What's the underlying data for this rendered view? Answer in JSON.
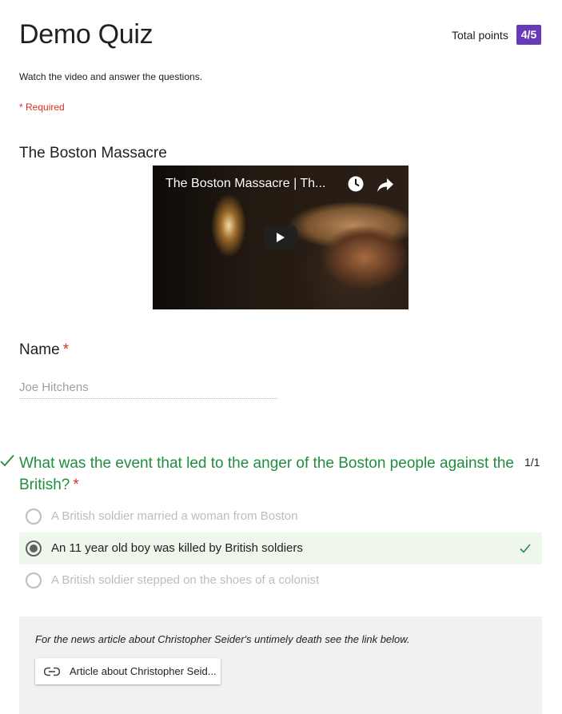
{
  "quiz": {
    "title": "Demo Quiz",
    "total_points_label": "Total points",
    "score": "4/5",
    "description": "Watch the video and answer the questions.",
    "required_note": "* Required"
  },
  "video_section": {
    "title": "The Boston Massacre",
    "video_title": "The Boston Massacre | Th...",
    "icons": [
      "clock-icon",
      "share-icon",
      "play-icon"
    ]
  },
  "name_question": {
    "label": "Name",
    "required_marker": "*",
    "value": "Joe Hitchens"
  },
  "mc_question": {
    "text": "What was the event that led to the anger of the Boston people against the British?",
    "required_marker": "*",
    "score": "1/1",
    "status": "correct",
    "options": [
      {
        "label": "A British soldier married a woman from Boston",
        "selected": false
      },
      {
        "label": "An 11 year old boy was killed by British soldiers",
        "selected": true,
        "correct": true
      },
      {
        "label": "A British soldier stepped on the shoes of a colonist",
        "selected": false
      }
    ],
    "feedback": {
      "text": "For the news article about Christopher Seider's untimely death see the link below.",
      "link_label": "Article about Christopher Seid..."
    }
  },
  "colors": {
    "accent": "#673ab7",
    "required": "#d93025",
    "correct": "#1e8e3e",
    "correct_bg": "#eff6ec"
  }
}
